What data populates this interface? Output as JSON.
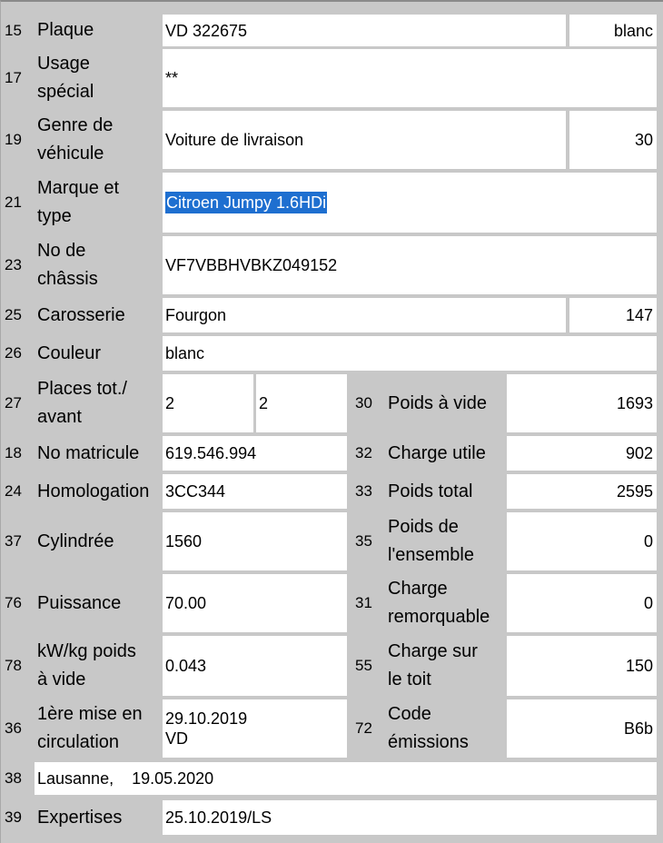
{
  "rows": {
    "plaque": {
      "num": "15",
      "label": "Plaque",
      "value": "VD 322675",
      "extra": "blanc"
    },
    "usage": {
      "num": "17",
      "label": "Usage\nspécial",
      "value": "**"
    },
    "genre": {
      "num": "19",
      "label": "Genre de\nvéhicule",
      "value": "Voiture de livraison",
      "extra": "30"
    },
    "marque": {
      "num": "21",
      "label": "Marque et\ntype",
      "value": "Citroen Jumpy 1.6HDi"
    },
    "chassis": {
      "num": "23",
      "label": "No de\nchâssis",
      "value": "VF7VBBHVBKZ049152"
    },
    "carosserie": {
      "num": "25",
      "label": "Carosserie",
      "value": "Fourgon",
      "extra": "147"
    },
    "couleur": {
      "num": "26",
      "label": "Couleur",
      "value": "blanc"
    },
    "places": {
      "num": "27",
      "label": "Places tot./\navant",
      "value": "2",
      "value2": "2"
    },
    "poids_vide": {
      "num": "30",
      "label": "Poids à vide",
      "value": "1693"
    },
    "matricule": {
      "num": "18",
      "label": "No matricule",
      "value": "619.546.994"
    },
    "charge_utile": {
      "num": "32",
      "label": "Charge utile",
      "value": "902"
    },
    "homologation": {
      "num": "24",
      "label": "Homologation",
      "value": "3CC344"
    },
    "poids_total": {
      "num": "33",
      "label": "Poids total",
      "value": "2595"
    },
    "cylindree": {
      "num": "37",
      "label": "Cylindrée",
      "value": "1560"
    },
    "poids_ensemble": {
      "num": "35",
      "label": "Poids de\nl'ensemble",
      "value": "0"
    },
    "puissance": {
      "num": "76",
      "label": "Puissance",
      "value": "70.00"
    },
    "charge_remorquable": {
      "num": "31",
      "label": "Charge\nremorquable",
      "value": "0"
    },
    "kwkg": {
      "num": "78",
      "label": "kW/kg poids\nà vide",
      "value": "0.043"
    },
    "charge_toit": {
      "num": "55",
      "label": "Charge sur\nle toit",
      "value": "150"
    },
    "mise_circulation": {
      "num": "36",
      "label": "1ère mise en\ncirculation",
      "value": "29.10.2019\nVD"
    },
    "code_emissions": {
      "num": "72",
      "label": "Code\némissions",
      "value": "B6b"
    },
    "lieu_date": {
      "num": "38",
      "value": "Lausanne,    19.05.2020"
    },
    "expertises": {
      "num": "39",
      "label": "Expertises",
      "value": "25.10.2019/LS"
    }
  },
  "colors": {
    "background": "#c8c8c8",
    "field": "#ffffff",
    "selection": "#1e6fd0"
  }
}
